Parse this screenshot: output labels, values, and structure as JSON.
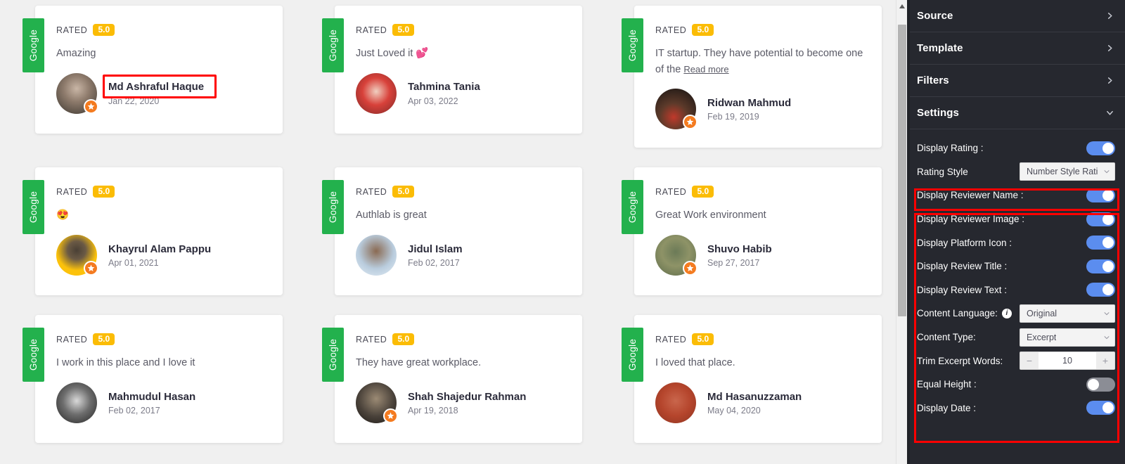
{
  "preview": {
    "platform_label": "Google",
    "rated_label": "RATED",
    "read_more_label": "Read more",
    "reviews": [
      {
        "platform": "Google",
        "rating": "5.0",
        "text": "Amazing",
        "read_more": false,
        "name": "Md Ashraful Haque",
        "date": "Jan 22, 2020",
        "has_platform_badge": true,
        "avatar_style": "photo-man-suit"
      },
      {
        "platform": "Google",
        "rating": "5.0",
        "text": "Just Loved it 💕",
        "read_more": false,
        "name": "Tahmina Tania",
        "date": "Apr 03, 2022",
        "has_platform_badge": false,
        "avatar_style": "photo-woman-red-hijab"
      },
      {
        "platform": "Google",
        "rating": "5.0",
        "text": "IT startup. They have potential to become one of the",
        "read_more": true,
        "name": "Ridwan Mahmud",
        "date": "Feb 19, 2019",
        "has_platform_badge": true,
        "avatar_style": "photo-dark-ball"
      },
      {
        "platform": "Google",
        "rating": "5.0",
        "text": "😍",
        "read_more": false,
        "name": "Khayrul Alam Pappu",
        "date": "Apr 01, 2021",
        "has_platform_badge": true,
        "avatar_style": "photo-yellow-bg-man"
      },
      {
        "platform": "Google",
        "rating": "5.0",
        "text": "Authlab is great",
        "read_more": false,
        "name": "Jidul Islam",
        "date": "Feb 02, 2017",
        "has_platform_badge": false,
        "avatar_style": "photo-light-blue-man"
      },
      {
        "platform": "Google",
        "rating": "5.0",
        "text": "Great Work environment",
        "read_more": false,
        "name": "Shuvo Habib",
        "date": "Sep 27, 2017",
        "has_platform_badge": true,
        "avatar_style": "photo-outdoor-man"
      },
      {
        "platform": "Google",
        "rating": "5.0",
        "text": "I work in this place and I love it",
        "read_more": false,
        "name": "Mahmudul Hasan",
        "date": "Feb 02, 2017",
        "has_platform_badge": false,
        "avatar_style": "photo-bw-man"
      },
      {
        "platform": "Google",
        "rating": "5.0",
        "text": "They have great workplace.",
        "read_more": false,
        "name": "Shah Shajedur Rahman",
        "date": "Apr 19, 2018",
        "has_platform_badge": true,
        "avatar_style": "photo-dark-man"
      },
      {
        "platform": "Google",
        "rating": "5.0",
        "text": "I loved that place.",
        "read_more": false,
        "name": "Md Hasanuzzaman",
        "date": "May 04, 2020",
        "has_platform_badge": false,
        "avatar_style": "photo-brick-man"
      }
    ]
  },
  "panel": {
    "accordions": [
      {
        "title": "Source",
        "expanded": false,
        "icon": "chevron-right-icon"
      },
      {
        "title": "Template",
        "expanded": false,
        "icon": "chevron-right-icon"
      },
      {
        "title": "Filters",
        "expanded": false,
        "icon": "chevron-right-icon"
      },
      {
        "title": "Settings",
        "expanded": true,
        "icon": "chevron-down-icon"
      }
    ],
    "settings": [
      {
        "label": "Display Rating :",
        "control": "toggle",
        "value": "on"
      },
      {
        "label": "Rating Style",
        "control": "select",
        "value": "Number Style Rati"
      },
      {
        "label": "Display Reviewer Name :",
        "control": "toggle",
        "value": "on"
      },
      {
        "label": "Display Reviewer Image :",
        "control": "toggle",
        "value": "on"
      },
      {
        "label": "Display Platform Icon :",
        "control": "toggle",
        "value": "on"
      },
      {
        "label": "Display Review Title :",
        "control": "toggle",
        "value": "on"
      },
      {
        "label": "Display Review Text :",
        "control": "toggle",
        "value": "on"
      },
      {
        "label": "Content Language:",
        "control": "select",
        "value": "Original",
        "info": true
      },
      {
        "label": "Content Type:",
        "control": "select",
        "value": "Excerpt"
      },
      {
        "label": "Trim Excerpt Words:",
        "control": "stepper",
        "value": "10",
        "minus": "−",
        "plus": "+"
      },
      {
        "label": "Equal Height :",
        "control": "toggle",
        "value": "off"
      },
      {
        "label": "Display Date :",
        "control": "toggle",
        "value": "on"
      }
    ]
  },
  "colors": {
    "highlight": "#ff0000",
    "toggle_on": "#5b8def",
    "toggle_off": "#8b8d95",
    "rating_pill": "#fbbc05",
    "platform_tab": "#23b14d",
    "platform_badge": "#f47b20",
    "panel_bg": "#26282f"
  },
  "scrollbar": {
    "up_arrow": "scroll-up-arrow-icon"
  }
}
